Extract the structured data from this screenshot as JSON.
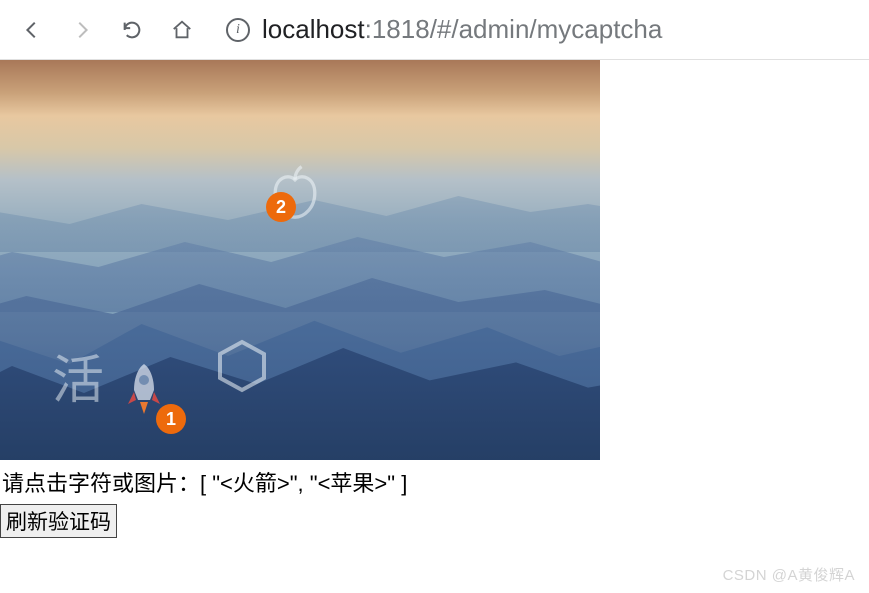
{
  "browser": {
    "url_host": "localhost",
    "url_path": ":1818/#/admin/mycaptcha"
  },
  "captcha": {
    "overlay_char": "活",
    "markers": [
      {
        "num": "1"
      },
      {
        "num": "2"
      }
    ],
    "prompt_prefix": "请点击字符或图片：",
    "prompt_items": "[ \"<火箭>\", \"<苹果>\" ]",
    "refresh_label": "刷新验证码"
  },
  "watermark": "CSDN @A黄俊辉A"
}
